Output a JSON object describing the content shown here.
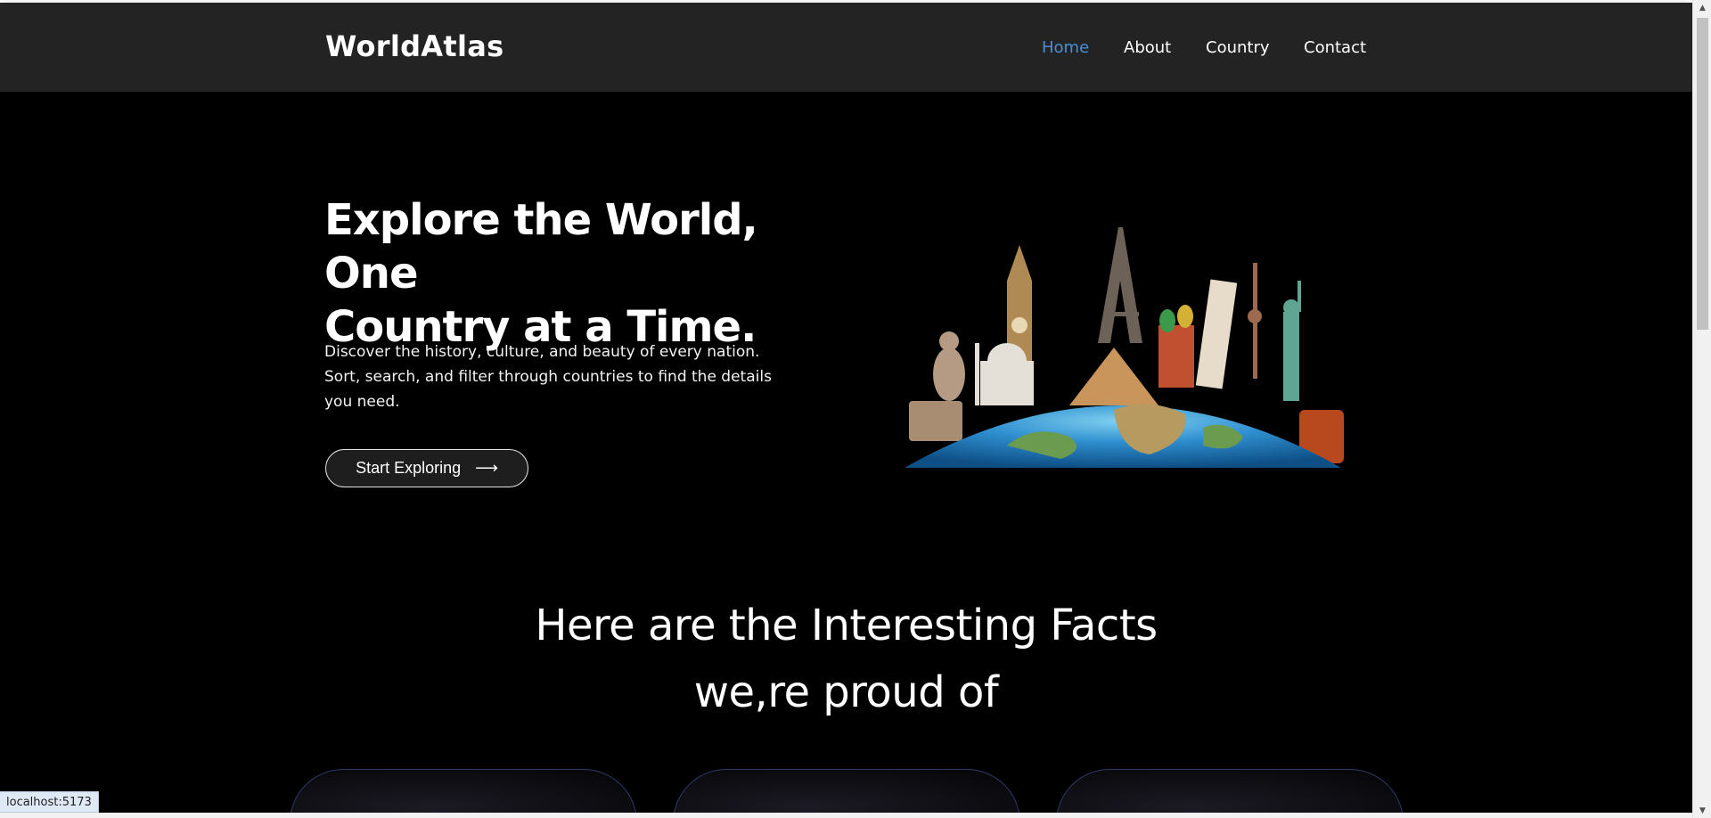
{
  "navbar": {
    "brand": "WorldAtlas",
    "links": [
      {
        "label": "Home",
        "active": true
      },
      {
        "label": "About",
        "active": false
      },
      {
        "label": "Country",
        "active": false
      },
      {
        "label": "Contact",
        "active": false
      }
    ]
  },
  "hero": {
    "title_line1": "Explore the World, One",
    "title_line2": "Country at a Time.",
    "text_line1": "Discover the history, culture, and beauty of every nation.",
    "text_line2": "Sort, search, and filter through countries to find the details",
    "text_line3": "you need.",
    "cta_label": "Start Exploring",
    "cta_icon": "arrow-right-icon"
  },
  "facts": {
    "title_line1": "Here are the Interesting Facts",
    "title_line2": "we,re proud of"
  },
  "status": {
    "url": "localhost:5173"
  },
  "colors": {
    "accent": "#4a8ed8",
    "navbar_bg": "#232323",
    "page_bg": "#000000"
  }
}
